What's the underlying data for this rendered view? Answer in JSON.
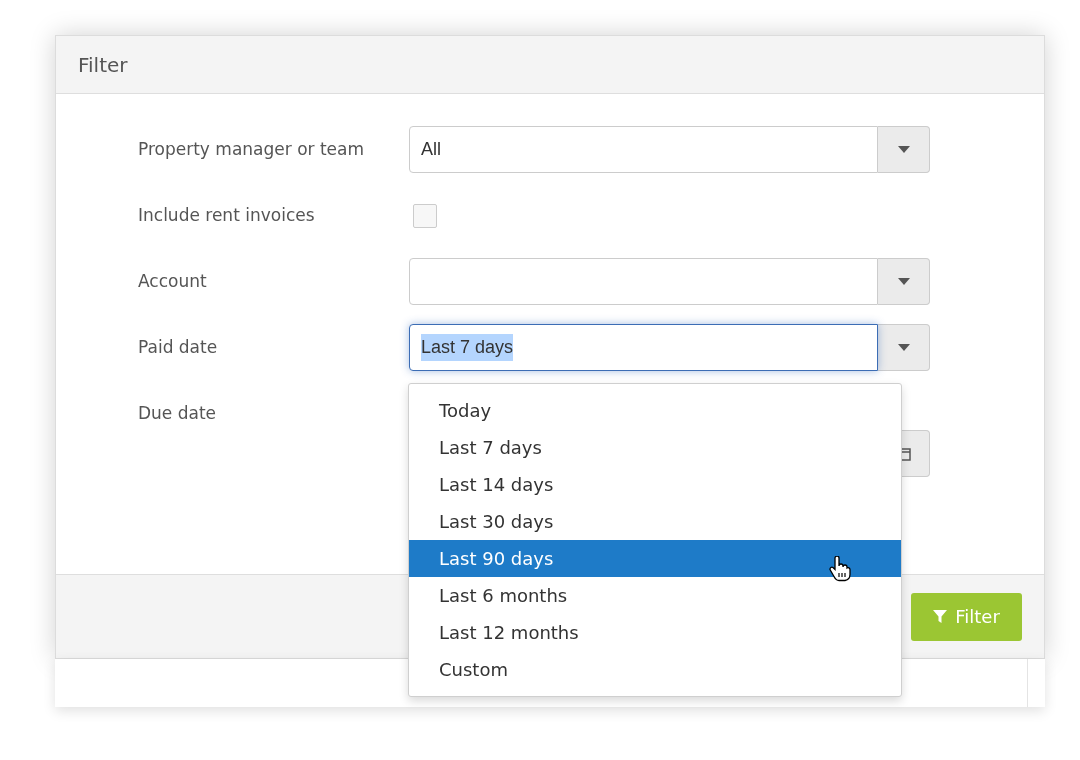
{
  "dialog": {
    "title": "Filter"
  },
  "fields": [
    {
      "kind": "select",
      "label": "Property manager or team",
      "value": "All",
      "focused": false
    },
    {
      "kind": "checkbox",
      "label": "Include rent invoices",
      "checked": false
    },
    {
      "kind": "select",
      "label": "Account",
      "focused": false
    },
    {
      "kind": "select",
      "label": "Paid date",
      "value": "Last 7 days",
      "focused": true
    },
    {
      "kind": "date",
      "label": "Due date"
    }
  ],
  "dropdown": {
    "options": [
      {
        "label": "Today",
        "selected": false
      },
      {
        "label": "Last 7 days",
        "selected": false
      },
      {
        "label": "Last 14 days",
        "selected": false
      },
      {
        "label": "Last 30 days",
        "selected": false
      },
      {
        "label": "Last 90 days",
        "selected": true
      },
      {
        "label": "Last 6 months",
        "selected": false
      },
      {
        "label": "Last 12 months",
        "selected": false
      },
      {
        "label": "Custom",
        "selected": false
      }
    ]
  },
  "buttons": [
    {
      "label": "Filter"
    }
  ]
}
